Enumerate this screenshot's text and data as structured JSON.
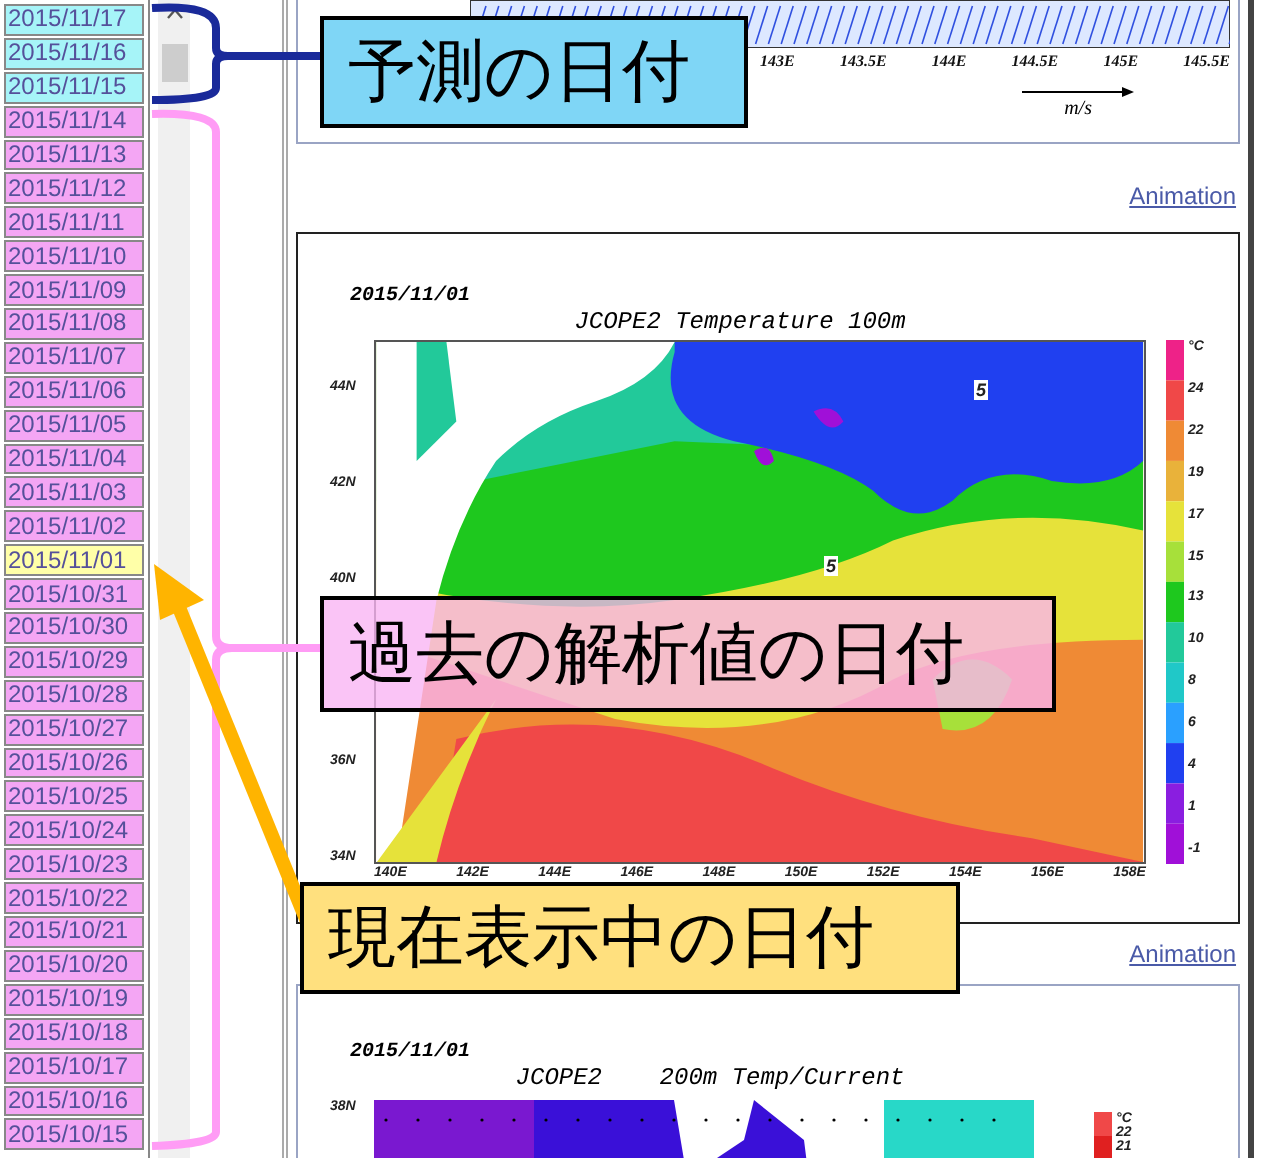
{
  "dates": [
    {
      "label": "2015/11/17",
      "kind": "forecast",
      "selected": false
    },
    {
      "label": "2015/11/16",
      "kind": "forecast",
      "selected": false
    },
    {
      "label": "2015/11/15",
      "kind": "forecast",
      "selected": false
    },
    {
      "label": "2015/11/14",
      "kind": "analysis",
      "selected": false
    },
    {
      "label": "2015/11/13",
      "kind": "analysis",
      "selected": false
    },
    {
      "label": "2015/11/12",
      "kind": "analysis",
      "selected": false
    },
    {
      "label": "2015/11/11",
      "kind": "analysis",
      "selected": false
    },
    {
      "label": "2015/11/10",
      "kind": "analysis",
      "selected": false
    },
    {
      "label": "2015/11/09",
      "kind": "analysis",
      "selected": false
    },
    {
      "label": "2015/11/08",
      "kind": "analysis",
      "selected": false
    },
    {
      "label": "2015/11/07",
      "kind": "analysis",
      "selected": false
    },
    {
      "label": "2015/11/06",
      "kind": "analysis",
      "selected": false
    },
    {
      "label": "2015/11/05",
      "kind": "analysis",
      "selected": false
    },
    {
      "label": "2015/11/04",
      "kind": "analysis",
      "selected": false
    },
    {
      "label": "2015/11/03",
      "kind": "analysis",
      "selected": false
    },
    {
      "label": "2015/11/02",
      "kind": "analysis",
      "selected": false
    },
    {
      "label": "2015/11/01",
      "kind": "analysis",
      "selected": true
    },
    {
      "label": "2015/10/31",
      "kind": "analysis",
      "selected": false
    },
    {
      "label": "2015/10/30",
      "kind": "analysis",
      "selected": false
    },
    {
      "label": "2015/10/29",
      "kind": "analysis",
      "selected": false
    },
    {
      "label": "2015/10/28",
      "kind": "analysis",
      "selected": false
    },
    {
      "label": "2015/10/27",
      "kind": "analysis",
      "selected": false
    },
    {
      "label": "2015/10/26",
      "kind": "analysis",
      "selected": false
    },
    {
      "label": "2015/10/25",
      "kind": "analysis",
      "selected": false
    },
    {
      "label": "2015/10/24",
      "kind": "analysis",
      "selected": false
    },
    {
      "label": "2015/10/23",
      "kind": "analysis",
      "selected": false
    },
    {
      "label": "2015/10/22",
      "kind": "analysis",
      "selected": false
    },
    {
      "label": "2015/10/21",
      "kind": "analysis",
      "selected": false
    },
    {
      "label": "2015/10/20",
      "kind": "analysis",
      "selected": false
    },
    {
      "label": "2015/10/19",
      "kind": "analysis",
      "selected": false
    },
    {
      "label": "2015/10/18",
      "kind": "analysis",
      "selected": false
    },
    {
      "label": "2015/10/17",
      "kind": "analysis",
      "selected": false
    },
    {
      "label": "2015/10/16",
      "kind": "analysis",
      "selected": false
    },
    {
      "label": "2015/10/15",
      "kind": "analysis",
      "selected": false
    }
  ],
  "forecast_panel": {
    "x_ticks": [
      "143E",
      "143.5E",
      "144E",
      "144.5E",
      "145E",
      "145.5E"
    ],
    "vector_scale_label": "m/s",
    "link": "Animation"
  },
  "temperature_panel": {
    "date": "2015/11/01",
    "title": "JCOPE2 Temperature 100m",
    "y_ticks": [
      "44N",
      "42N",
      "40N",
      "36N",
      "34N"
    ],
    "x_ticks": [
      "140E",
      "142E",
      "144E",
      "146E",
      "148E",
      "150E",
      "152E",
      "154E",
      "156E",
      "158E"
    ],
    "contour_labels": [
      "5",
      "5"
    ],
    "colorbar": {
      "unit": "°C",
      "labels": [
        "24",
        "22",
        "19",
        "17",
        "15",
        "13",
        "10",
        "8",
        "6",
        "4",
        "1",
        "-1"
      ]
    },
    "link": "Animation"
  },
  "current_panel": {
    "date": "2015/11/01",
    "title": "JCOPE2    200m Temp/Current",
    "y_ticks": [
      "38N"
    ],
    "colorbar": {
      "unit": "°C",
      "labels": [
        "22",
        "21"
      ]
    }
  },
  "callouts": [
    {
      "kind": "forecast",
      "text": "予測の日付"
    },
    {
      "kind": "analysis",
      "text": "過去の解析値の日付"
    },
    {
      "kind": "current",
      "text": "現在表示中の日付"
    }
  ]
}
